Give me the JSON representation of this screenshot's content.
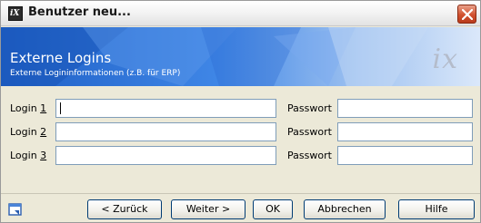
{
  "window": {
    "title": "Benutzer neu...",
    "app_icon_text": "iX",
    "close_icon": "close-icon"
  },
  "banner": {
    "title": "Externe Logins",
    "subtitle": "Externe Logininformationen (z.B. für ERP)",
    "logo_text": "ix"
  },
  "form": {
    "rows": [
      {
        "label_prefix": "Login ",
        "label_mnemonic": "1",
        "login_value": "",
        "password_label": "Passwort",
        "password_value": ""
      },
      {
        "label_prefix": "Login ",
        "label_mnemonic": "2",
        "login_value": "",
        "password_label": "Passwort",
        "password_value": ""
      },
      {
        "label_prefix": "Login ",
        "label_mnemonic": "3",
        "login_value": "",
        "password_label": "Passwort",
        "password_value": ""
      }
    ]
  },
  "footer": {
    "help_icon": "help-window-icon",
    "back_label": "< Zurück",
    "next_label": "Weiter >",
    "ok_label": "OK",
    "cancel_label": "Abbrechen",
    "help_label": "Hilfe"
  },
  "colors": {
    "banner_start": "#1e5fc6",
    "banner_end": "#dbe8fa",
    "field_border": "#7f9db9",
    "button_border": "#003c74",
    "close_button": "#d2512f"
  }
}
